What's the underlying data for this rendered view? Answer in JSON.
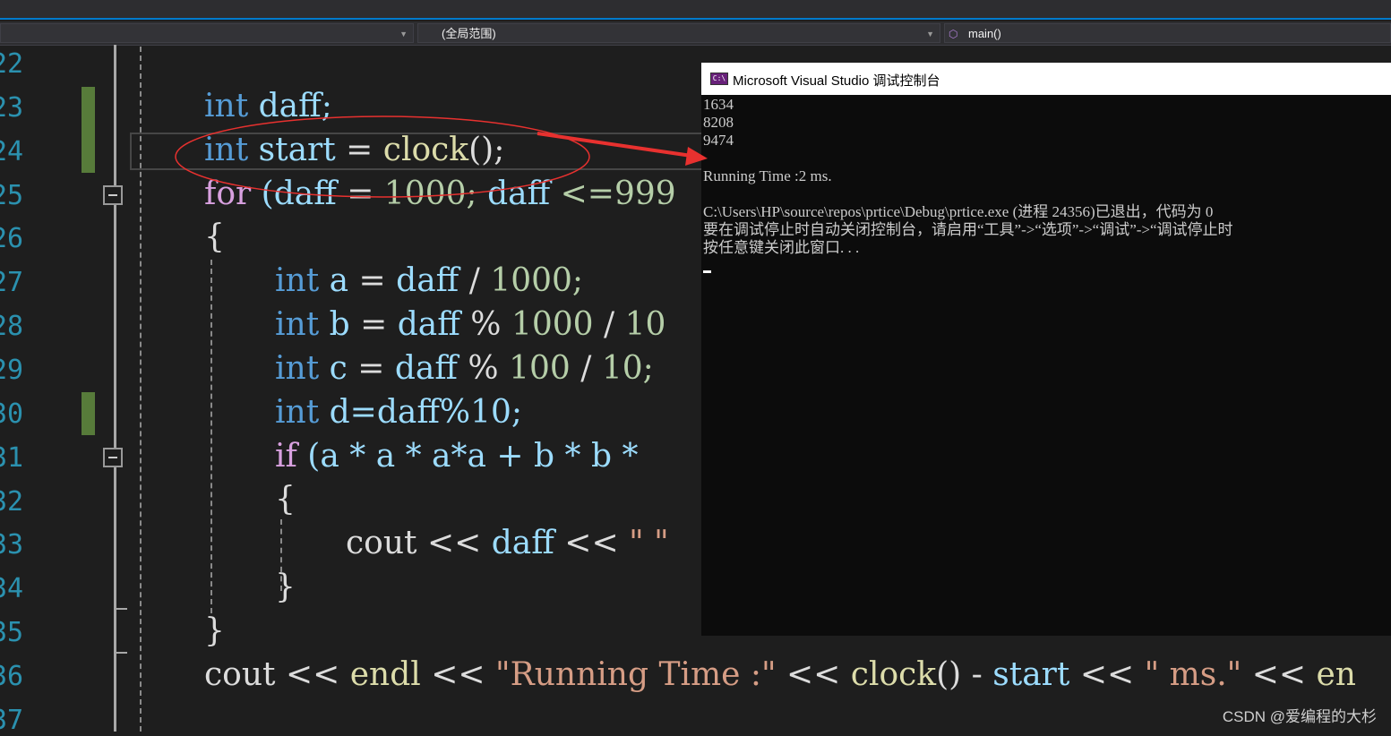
{
  "navbar": {
    "scope_label": "(全局范围)",
    "member_label": "main()",
    "member_icon": "cube-icon"
  },
  "editor": {
    "line_numbers": [
      "22",
      "23",
      "24",
      "25",
      "26",
      "27",
      "28",
      "29",
      "30",
      "31",
      "32",
      "33",
      "34",
      "35",
      "36",
      "37"
    ],
    "lines": {
      "l23": {
        "kw": "int",
        "rest": "daff;"
      },
      "l24": {
        "kw": "int",
        "var": "start",
        "eq": "=",
        "fn": "clock",
        "tail": "();"
      },
      "l25": {
        "ctl": "for",
        "a": "(daff",
        "b": "=",
        "n1": "1000;",
        "c": "daff",
        "d": "<=999"
      },
      "l26": {
        "brace": "{"
      },
      "l27": {
        "kw": "int",
        "v": "a",
        "eq": "=",
        "v2": "daff",
        "op": "/",
        "n": "1000;"
      },
      "l28": {
        "kw": "int",
        "v": "b",
        "eq": "=",
        "v2": "daff",
        "op": "%",
        "n": "1000",
        "op2": "/",
        "n2": "10"
      },
      "l29": {
        "kw": "int",
        "v": "c",
        "eq": "=",
        "v2": "daff",
        "op": "%",
        "n": "100",
        "op2": "/",
        "n2": "10;"
      },
      "l30": {
        "kw": "int",
        "rest": "d=daff%10;"
      },
      "l31": {
        "ctl": "if",
        "rest": "(a * a * a*a + b * b *"
      },
      "l32": {
        "brace": "{"
      },
      "l33": {
        "cout": "cout",
        "op": "<<",
        "v": "daff",
        "op2": "<<",
        "str": "\" \""
      },
      "l34": {
        "brace": "}"
      },
      "l35": {
        "brace": "}"
      },
      "l36": {
        "cout": "cout",
        "op1": "<<",
        "endl": "endl",
        "op2": "<<",
        "str": "\"Running Time :\"",
        "op3": "<<",
        "fn": "clock",
        "p": "()",
        "minus": "-",
        "v": "start",
        "op4": "<<",
        "str2": "\" ms.\"",
        "op5": "<<",
        "tail": "en"
      }
    }
  },
  "console": {
    "title": "Microsoft Visual Studio 调试控制台",
    "icon": "console-app-icon",
    "output": [
      "1634",
      "8208",
      "9474",
      "",
      "Running Time :2 ms.",
      "",
      "C:\\Users\\HP\\source\\repos\\prtice\\Debug\\prtice.exe (进程 24356)已退出，代码为 0",
      "要在调试停止时自动关闭控制台，请启用“工具”->“选项”->“调试”->“调试停止时",
      "按任意键关闭此窗口. . ."
    ]
  },
  "annotation": {
    "shape": "red-ellipse",
    "arrow": "red-arrow",
    "color": "#e8312f"
  },
  "watermark": "CSDN @爱编程的大杉"
}
